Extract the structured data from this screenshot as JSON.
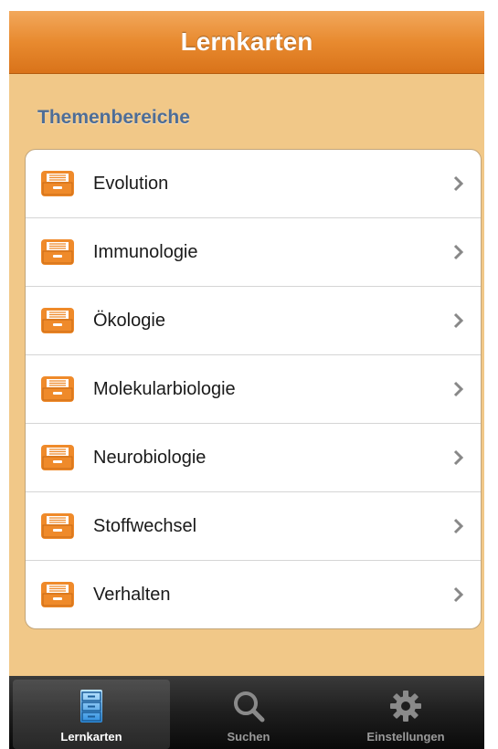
{
  "navbar": {
    "title": "Lernkarten"
  },
  "section": {
    "header": "Themenbereiche"
  },
  "topics": [
    {
      "label": "Evolution",
      "icon": "card-box-icon"
    },
    {
      "label": "Immunologie",
      "icon": "card-box-icon"
    },
    {
      "label": "Ökologie",
      "icon": "card-box-icon"
    },
    {
      "label": "Molekularbiologie",
      "icon": "card-box-icon"
    },
    {
      "label": "Neurobiologie",
      "icon": "card-box-icon"
    },
    {
      "label": "Stoffwechsel",
      "icon": "card-box-icon"
    },
    {
      "label": "Verhalten",
      "icon": "card-box-icon"
    }
  ],
  "tabbar": {
    "tabs": [
      {
        "label": "Lernkarten",
        "icon": "file-cabinet-icon",
        "selected": true
      },
      {
        "label": "Suchen",
        "icon": "magnifier-icon",
        "selected": false
      },
      {
        "label": "Einstellungen",
        "icon": "gear-icon",
        "selected": false
      }
    ]
  },
  "colors": {
    "navbar": "#e88a2f",
    "background": "#f1c888",
    "section_header": "#4e6d96",
    "icon_orange": "#ef8a2a"
  }
}
